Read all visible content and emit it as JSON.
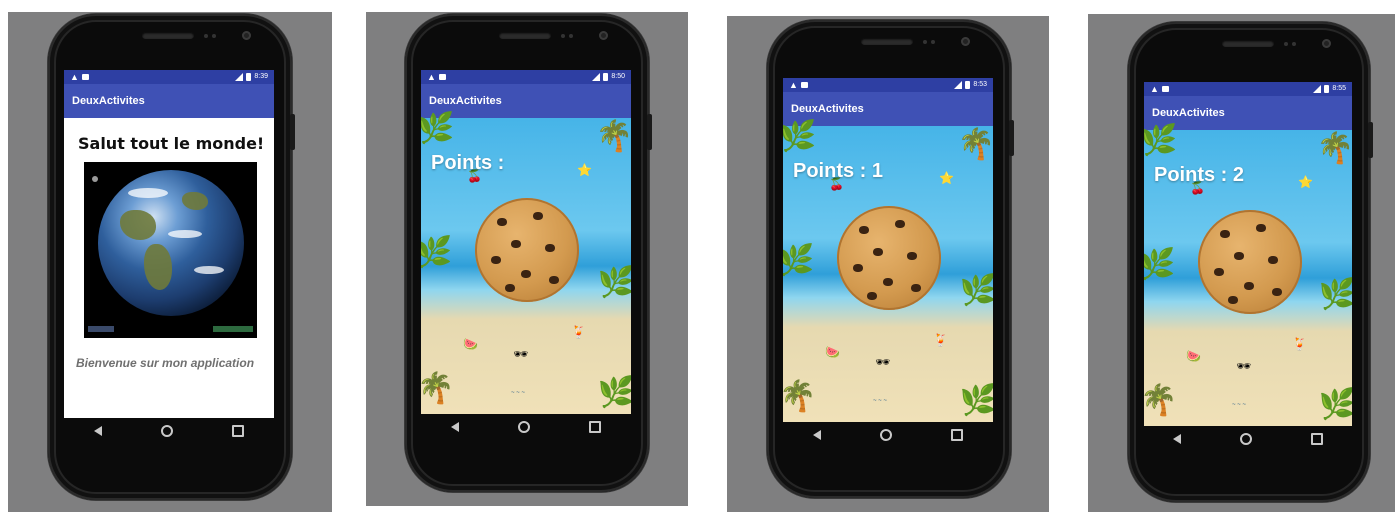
{
  "app_title": "DeuxActivites",
  "screens": [
    {
      "time": "8:39",
      "heading": "Salut tout le monde!",
      "welcome": "Bienvenue sur mon application"
    },
    {
      "time": "8:50",
      "points": "Points :"
    },
    {
      "time": "8:53",
      "points": "Points : 1"
    },
    {
      "time": "8:55",
      "points": "Points : 2"
    }
  ],
  "icons": {
    "status": [
      "warning-icon",
      "message-icon",
      "signal-icon",
      "battery-icon"
    ],
    "nav": [
      "back-icon",
      "home-icon",
      "recent-apps-icon"
    ],
    "beach": [
      "palm-leaf-icon",
      "starfish-icon",
      "cherries-icon",
      "watermelon-icon",
      "sunglasses-icon",
      "drink-icon"
    ]
  },
  "colors": {
    "statusbar": "#2e3fa3",
    "appbar": "#3f51b5",
    "panel": "#7f7f80"
  }
}
